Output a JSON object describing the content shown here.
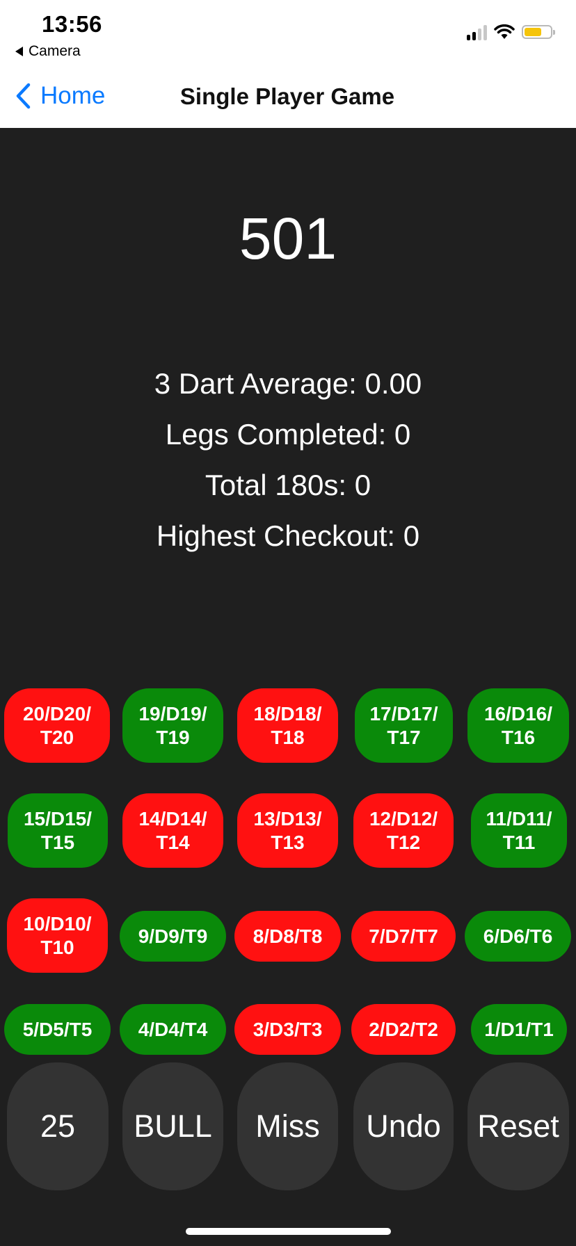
{
  "status": {
    "time": "13:56",
    "back_app": "Camera"
  },
  "nav": {
    "back_label": "Home",
    "title": "Single Player Game"
  },
  "score": "501",
  "stats": {
    "average": "3 Dart Average: 0.00",
    "legs": "Legs Completed: 0",
    "total180": "Total 180s: 0",
    "checkout": "Highest Checkout: 0"
  },
  "colors": {
    "red": "#ff1111",
    "green": "#0a8a0a",
    "grey": "#333333",
    "background": "#1f1f1f",
    "link": "#0a7aff"
  },
  "buttons": {
    "b20": "20/D20/ T20",
    "b19": "19/D19/ T19",
    "b18": "18/D18/ T18",
    "b17": "17/D17/ T17",
    "b16": "16/D16/ T16",
    "b15": "15/D15/ T15",
    "b14": "14/D14/ T14",
    "b13": "13/D13/ T13",
    "b12": "12/D12/ T12",
    "b11": "11/D11/ T11",
    "b10": "10/D10/ T10",
    "b9": "9/D9/T9",
    "b8": "8/D8/T8",
    "b7": "7/D7/T7",
    "b6": "6/D6/T6",
    "b5": "5/D5/T5",
    "b4": "4/D4/T4",
    "b3": "3/D3/T3",
    "b2": "2/D2/T2",
    "b1": "1/D1/T1"
  },
  "actions": {
    "b25": "25",
    "bull": "BULL",
    "miss": "Miss",
    "undo": "Undo",
    "reset": "Reset"
  }
}
